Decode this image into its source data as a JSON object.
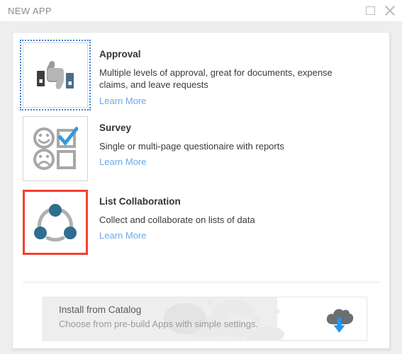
{
  "window": {
    "title": "NEW APP",
    "controls": {
      "maximize_name": "maximize-icon",
      "close_name": "close-icon"
    }
  },
  "colors": {
    "selected_border": "#f4402f",
    "focus_outline": "#3d7fd6",
    "link": "#6ea8e8",
    "checkbox_blue": "#3399dd",
    "node_teal": "#2e6e8e",
    "arrow_blue": "#2196f3",
    "panel_bg": "#ffffff",
    "page_bg": "#eeeeee"
  },
  "options": [
    {
      "id": "approval",
      "title": "Approval",
      "description": "Multiple levels of approval, great for documents, expense claims, and leave requests",
      "learn_more": "Learn More",
      "icon": "thumbs-up-down-icon",
      "state": "focused"
    },
    {
      "id": "survey",
      "title": "Survey",
      "description": "Single or multi-page questionaire with reports",
      "learn_more": "Learn More",
      "icon": "survey-faces-checkbox-icon",
      "state": "default"
    },
    {
      "id": "list-collaboration",
      "title": "List Collaboration",
      "description": "Collect and collaborate on lists of data",
      "learn_more": "Learn More",
      "icon": "collaboration-network-icon",
      "state": "selected"
    }
  ],
  "catalog": {
    "title": "Install from Catalog",
    "subtitle": "Choose from pre-build Apps with simple settings.",
    "icon": "cloud-download-icon"
  }
}
